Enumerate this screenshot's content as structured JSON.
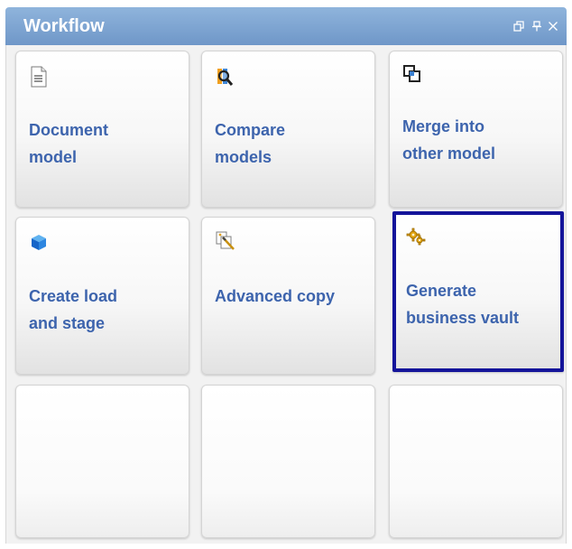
{
  "panel": {
    "title": "Workflow",
    "controls": [
      {
        "name": "float-window-icon"
      },
      {
        "name": "pin-icon"
      },
      {
        "name": "close-icon"
      }
    ]
  },
  "tiles": [
    {
      "label": "Document\nmodel",
      "icon": "document-icon"
    },
    {
      "label": "Compare\nmodels",
      "icon": "compare-magnifier-icon"
    },
    {
      "label": "Merge into\nother model",
      "icon": "merge-squares-icon"
    },
    {
      "label": "Create load\nand stage",
      "icon": "blue-cube-icon"
    },
    {
      "label": "Advanced copy",
      "icon": "copy-wand-icon"
    },
    {
      "label": "Generate\nbusiness vault",
      "icon": "gear-icon",
      "selected": true
    },
    {
      "label": "",
      "icon": ""
    },
    {
      "label": "",
      "icon": ""
    },
    {
      "label": "",
      "icon": ""
    }
  ],
  "colors": {
    "title_bar": "#7aa1cf",
    "label_text": "#3d64ad",
    "selection_border": "#14149a"
  }
}
